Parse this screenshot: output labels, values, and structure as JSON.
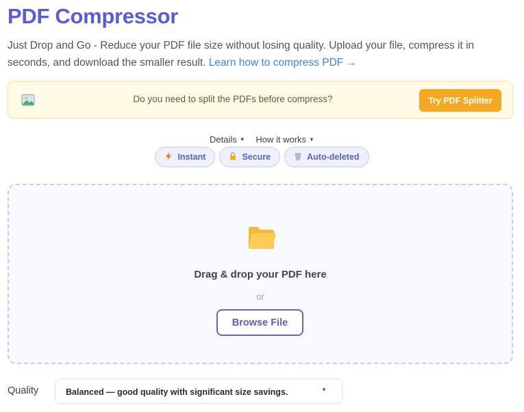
{
  "header": {
    "title": "PDF Compressor",
    "subtitle": "Just Drop and Go - Reduce your PDF file size without losing quality. Upload your file, compress it in seconds, and download the smaller result.",
    "learn_link": "Learn how to compress PDF →"
  },
  "banner": {
    "icon": "image-icon",
    "text": "Do you need to split the PDFs before compress?",
    "button_label": "Try PDF Splitter",
    "button_color": "#f7a823"
  },
  "toggles": {
    "details": "Details",
    "how_it_works": "How it works"
  },
  "chips": [
    {
      "label": "Instant",
      "icon": "lightning-icon"
    },
    {
      "label": "Secure",
      "icon": "lock-icon"
    },
    {
      "label": "Auto-deleted",
      "icon": "trash-icon"
    }
  ],
  "dropzone": {
    "icon": "folder-icon",
    "title": "Drag & drop your PDF here",
    "or_text": "or",
    "browse_label": "Browse File"
  },
  "quality": {
    "label": "Quality",
    "selected": "Balanced — good quality with significant size savings."
  },
  "colors": {
    "brand": "#5b5bd6",
    "link": "#3b82f6"
  }
}
